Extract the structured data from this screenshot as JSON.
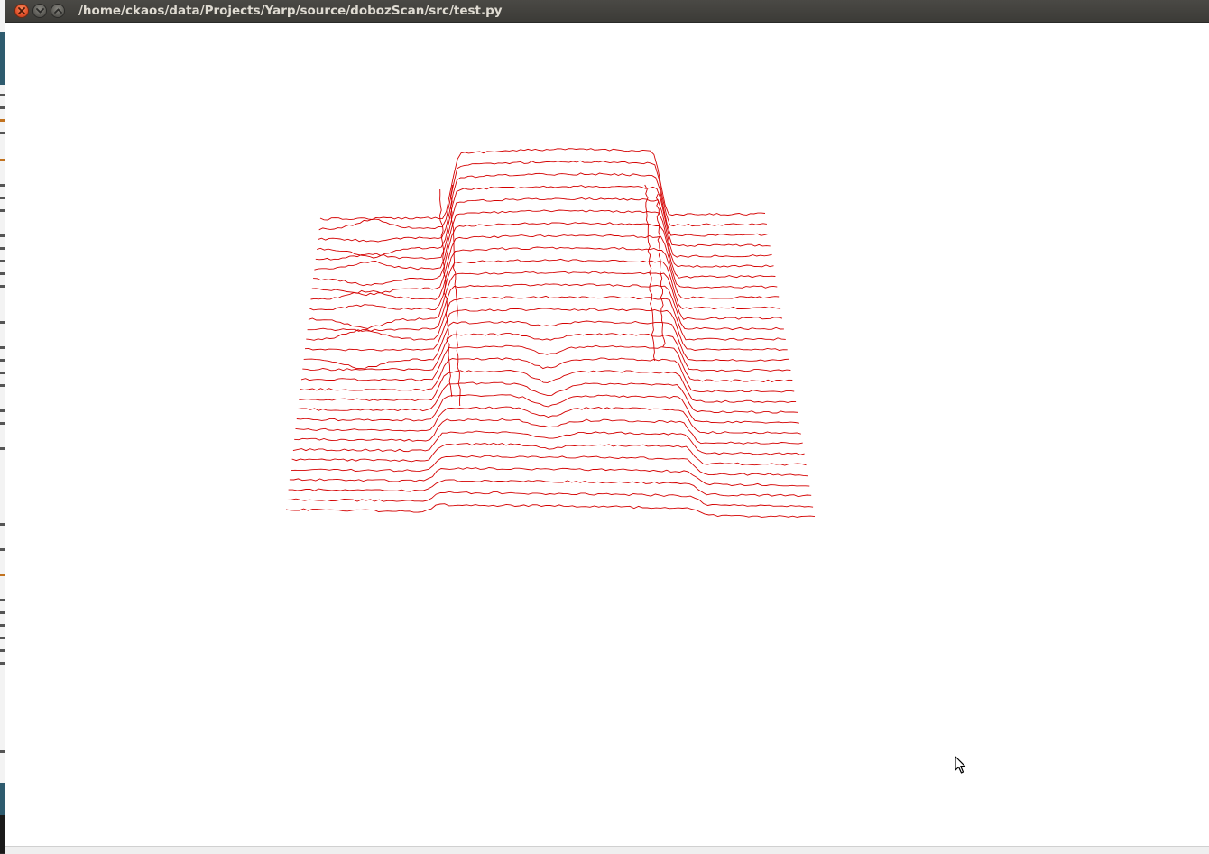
{
  "window": {
    "title": "/home/ckaos/data/Projects/Yarp/source/dobozScan/src/test.py"
  },
  "titlebar_buttons": [
    {
      "name": "close-button",
      "icon": "close-icon"
    },
    {
      "name": "minimize-button",
      "icon": "chevron-down-icon"
    },
    {
      "name": "maximize-button",
      "icon": "chevron-up-icon"
    }
  ],
  "colors": {
    "scan_line": "#d40000",
    "close_button": "#e0502a",
    "titlebar": "#3c3b37"
  },
  "plot": {
    "type": "3d-wireframe-scan",
    "line_count": 30
  }
}
